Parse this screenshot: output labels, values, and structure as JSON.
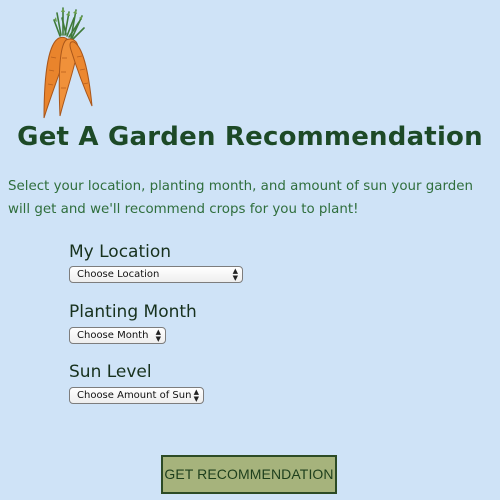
{
  "header": {
    "logo_icon": "carrots-icon",
    "title": "Get A Garden Recommendation"
  },
  "intro": {
    "text": "Select your location, planting month, and amount of sun your garden will get and we'll recommend crops for you to plant!"
  },
  "form": {
    "location": {
      "label": "My Location",
      "selected": "Choose Location"
    },
    "month": {
      "label": "Planting Month",
      "selected": "Choose Month"
    },
    "sun": {
      "label": "Sun Level",
      "selected": "Choose Amount of Sun"
    },
    "submit_label": "GET RECOMMENDATION"
  },
  "colors": {
    "background": "#cfe3f7",
    "title": "#1d4a27",
    "intro_text": "#2f6e3c",
    "button_fill": "#a6b37c",
    "button_border": "#2c4b25",
    "carrot": "#ee8a2e"
  }
}
